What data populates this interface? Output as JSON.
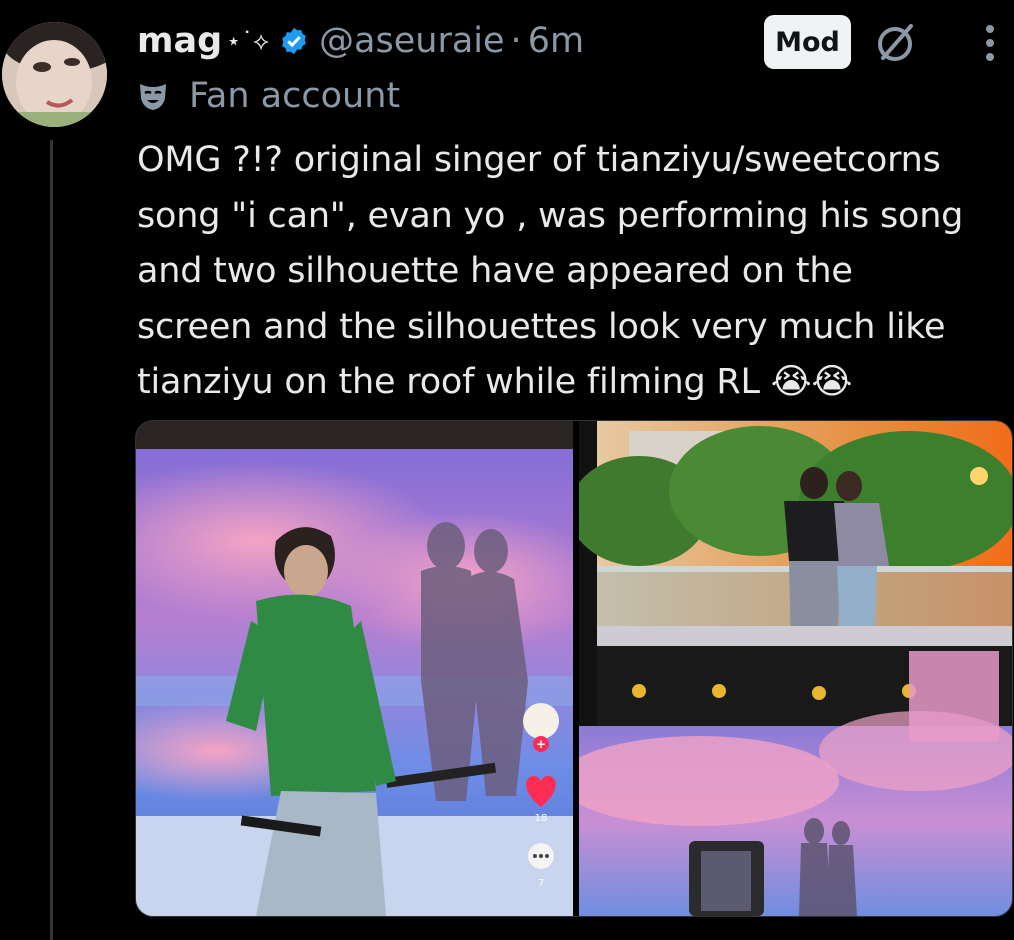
{
  "post": {
    "author_name": "mag",
    "name_decoration": "⋆˙⟡",
    "handle": "@aseuraie",
    "separator": "·",
    "time": "6m",
    "mod_label": "Mod",
    "affiliation": "Fan account",
    "text_lines": [
      "OMG ?!? original singer of tianziyu/sweetcorns",
      "song \"i can\", evan yo , was performing his song",
      "and two silhouette have appeared on the",
      "screen and the silhouettes look very much like",
      "tianziyu on the roof while filming RL 😭😭"
    ]
  },
  "left_image": {
    "overlay": {
      "likes": "18",
      "comments": "7"
    }
  },
  "icons": {
    "verified": "verified-badge-icon",
    "muted": "no-entry-icon",
    "more": "more-vertical-icon",
    "affiliation": "theater-mask-icon"
  },
  "colors": {
    "background": "#000000",
    "text": "#e7e9ea",
    "secondary": "#8b98a5",
    "verified": "#1d9bf0"
  }
}
